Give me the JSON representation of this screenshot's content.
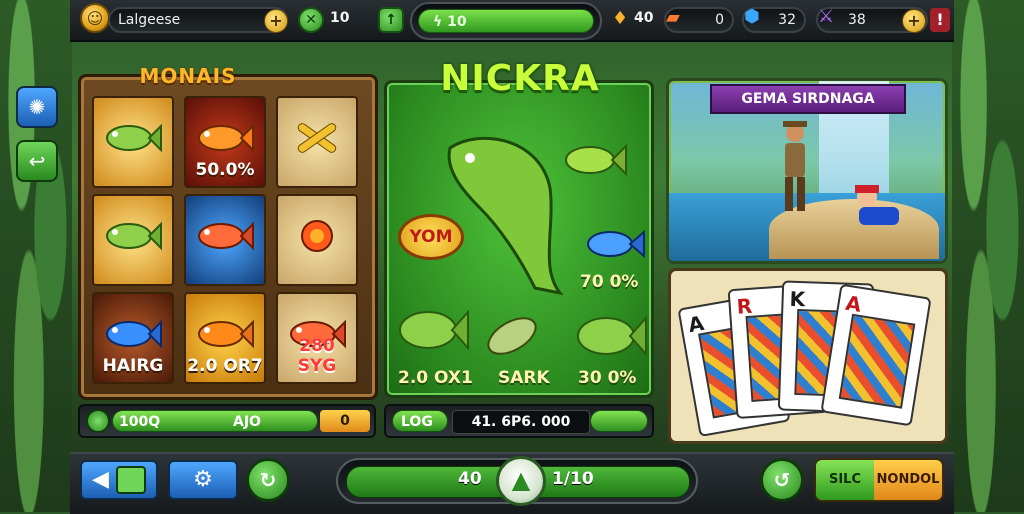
{
  "topbar": {
    "player_name": "Lalgeese",
    "gem_count": "10",
    "center_meter": "10",
    "fire_count": "40",
    "ticket_count": "0",
    "shield_count": "32",
    "sword_count": "38"
  },
  "left_panel": {
    "title": "MONAIS",
    "slots": [
      {
        "caption": ""
      },
      {
        "caption": "50.0%"
      },
      {
        "caption": ""
      },
      {
        "caption": ""
      },
      {
        "caption": ""
      },
      {
        "caption": ""
      },
      {
        "caption": "HAIRG"
      },
      {
        "caption": "2.0 OR7"
      },
      {
        "caption": "280 SYG"
      }
    ],
    "bar_left": "100Q",
    "bar_mid": "AJO",
    "bar_right": "0"
  },
  "mid_panel": {
    "title": "NICKRA",
    "badge": "YOM",
    "pct": "70 0%",
    "cap1": "2.0 OX1",
    "cap2": "SARK",
    "cap3": "30 0%",
    "bar_left": "LOG",
    "bar_value": "41. 6P6. 000"
  },
  "right_panel": {
    "banner": "GEMA SIRDNAGA"
  },
  "cards": [
    "A",
    "R",
    "K",
    "A"
  ],
  "bottombar": {
    "bet_left": "40",
    "bet_right": "1/10",
    "action_left": "SILC",
    "action_right": "NONDOL"
  },
  "colors": {
    "accent_green": "#2f9a1f",
    "gold": "#e2a11a",
    "purple_banner": "#8b3fb0"
  }
}
